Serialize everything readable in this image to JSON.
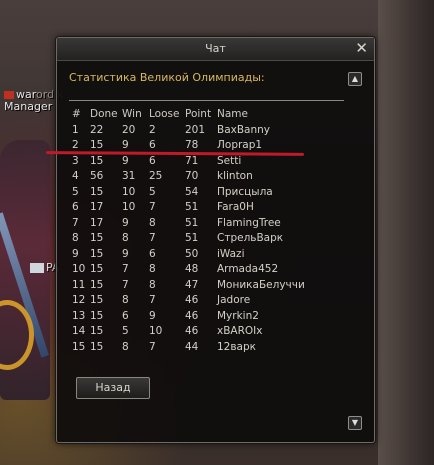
{
  "window": {
    "title": "Чат",
    "close_glyph": "✕",
    "stats_label": "Статистика Великой Олимпиады:",
    "back_label": "Назад",
    "scroll_up_icon": "up-arrow-icon",
    "scroll_down_icon": "down-arrow-icon"
  },
  "background": {
    "nameplate_1": "war",
    "nameplate_1_tail": "ordik",
    "nameplate_2": "Manager",
    "pa_tag": "PA"
  },
  "table": {
    "headers": [
      "#",
      "Done",
      "Win",
      "Loose",
      "Point",
      "Name"
    ],
    "rows": [
      {
        "n": "1",
        "done": "22",
        "win": "20",
        "loose": "2",
        "point": "201",
        "name": "BaxBanny"
      },
      {
        "n": "2",
        "done": "15",
        "win": "9",
        "loose": "6",
        "point": "78",
        "name": "Лорrap1"
      },
      {
        "n": "3",
        "done": "15",
        "win": "9",
        "loose": "6",
        "point": "71",
        "name": "Setti"
      },
      {
        "n": "4",
        "done": "56",
        "win": "31",
        "loose": "25",
        "point": "70",
        "name": "klinton"
      },
      {
        "n": "5",
        "done": "15",
        "win": "10",
        "loose": "5",
        "point": "54",
        "name": "Присцыла"
      },
      {
        "n": "6",
        "done": "17",
        "win": "10",
        "loose": "7",
        "point": "51",
        "name": "Fara0H"
      },
      {
        "n": "7",
        "done": "17",
        "win": "9",
        "loose": "8",
        "point": "51",
        "name": "FlamingTree"
      },
      {
        "n": "8",
        "done": "15",
        "win": "8",
        "loose": "7",
        "point": "51",
        "name": "СтрельВарк"
      },
      {
        "n": "9",
        "done": "15",
        "win": "9",
        "loose": "6",
        "point": "50",
        "name": "iWazi"
      },
      {
        "n": "10",
        "done": "15",
        "win": "7",
        "loose": "8",
        "point": "48",
        "name": "Armada452"
      },
      {
        "n": "11",
        "done": "15",
        "win": "7",
        "loose": "8",
        "point": "47",
        "name": "МоникаБелуччи"
      },
      {
        "n": "12",
        "done": "15",
        "win": "8",
        "loose": "7",
        "point": "46",
        "name": "Jadore"
      },
      {
        "n": "13",
        "done": "15",
        "win": "6",
        "loose": "9",
        "point": "46",
        "name": "Myrkin2"
      },
      {
        "n": "14",
        "done": "15",
        "win": "5",
        "loose": "10",
        "point": "46",
        "name": "xBAROIx"
      },
      {
        "n": "15",
        "done": "15",
        "win": "8",
        "loose": "7",
        "point": "44",
        "name": "12варк"
      }
    ]
  },
  "colors": {
    "label_gold": "#d8b860",
    "highlight_red": "#c01a2a",
    "text": "#d4d0c8"
  }
}
